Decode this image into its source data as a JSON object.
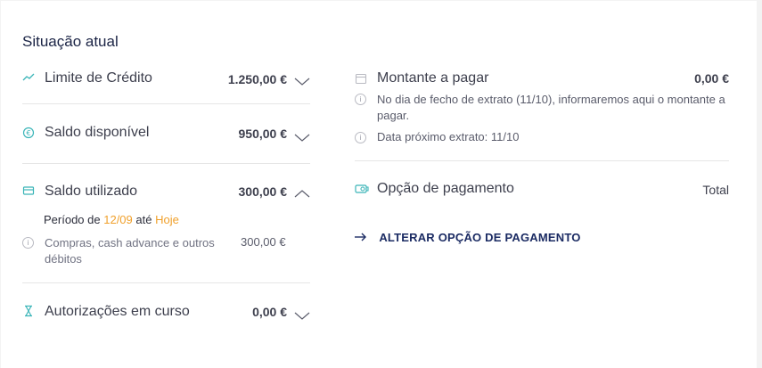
{
  "section": {
    "title": "Situação atual"
  },
  "left": {
    "credit_limit": {
      "label": "Limite de Crédito",
      "value": "1.250,00 €"
    },
    "available_balance": {
      "label": "Saldo disponível",
      "value": "950,00 €"
    },
    "used_balance": {
      "label": "Saldo utilizado",
      "value": "300,00 €",
      "period_prefix": "Período de",
      "period_from": "12/09",
      "period_mid": "até",
      "period_to": "Hoje",
      "detail_label_1": "Compras, cash advance e outros",
      "detail_label_2": "débitos",
      "detail_value": "300,00 €"
    },
    "authorizations": {
      "label": "Autorizações em curso",
      "value": "0,00 €"
    }
  },
  "right": {
    "amount_due": {
      "label": "Montante a pagar",
      "value": "0,00 €",
      "note_1": "No dia de fecho de extrato (11/10), informaremos aqui o montante a",
      "note_1b": "pagar.",
      "note_2": "Data próximo extrato: 11/10"
    },
    "payment_option": {
      "label": "Opção de pagamento",
      "value": "Total"
    },
    "change_link": "ALTERAR OPÇÃO DE PAGAMENTO"
  },
  "colors": {
    "accent": "#3bb5b8",
    "orange": "#f0a02b",
    "navy": "#1b2b63"
  }
}
